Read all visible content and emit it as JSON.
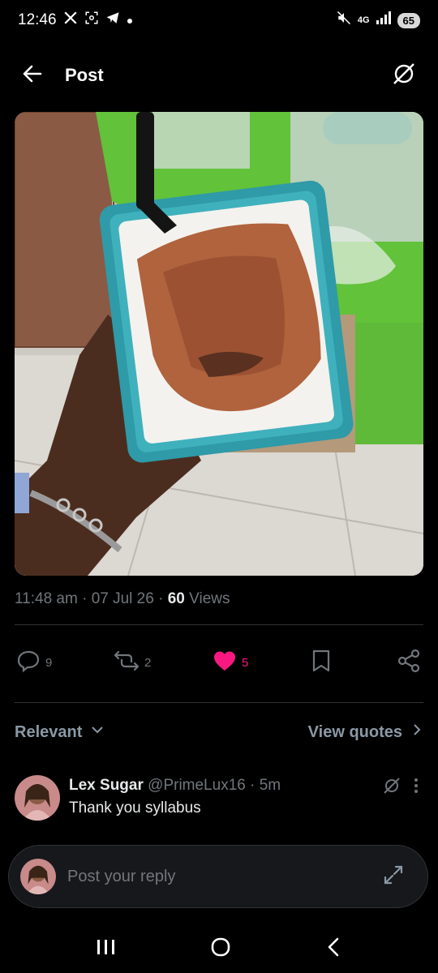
{
  "status_bar": {
    "time": "12:46",
    "network": "4G",
    "battery": "65",
    "icons": [
      "x-logo-icon",
      "screenshot-icon",
      "telegram-icon",
      "dot-icon",
      "mute-icon",
      "signal-icon"
    ]
  },
  "header": {
    "back_icon": "arrow-left-icon",
    "title": "Post",
    "grok_icon": "grok-icon"
  },
  "post": {
    "image_alt": "Hand holding a teal takeaway container of white rice with stew and a black fork",
    "time": "11:48 am",
    "date": "07 Jul 26",
    "views_count": "60",
    "views_label": "Views",
    "separator": "·"
  },
  "actions": {
    "replies": "9",
    "reposts": "2",
    "likes": "5",
    "colors": {
      "muted": "#71767b",
      "like": "#f91880"
    }
  },
  "replies_filter": {
    "sort_label": "Relevant",
    "quotes_label": "View quotes"
  },
  "replies": [
    {
      "display_name": "Lex Sugar",
      "handle": "@PrimeLux16",
      "age": "5m",
      "text": "Thank you syllabus"
    }
  ],
  "composer": {
    "placeholder": "Post your reply"
  },
  "nav": {
    "icons": [
      "recents-icon",
      "home-icon",
      "back-icon"
    ]
  }
}
